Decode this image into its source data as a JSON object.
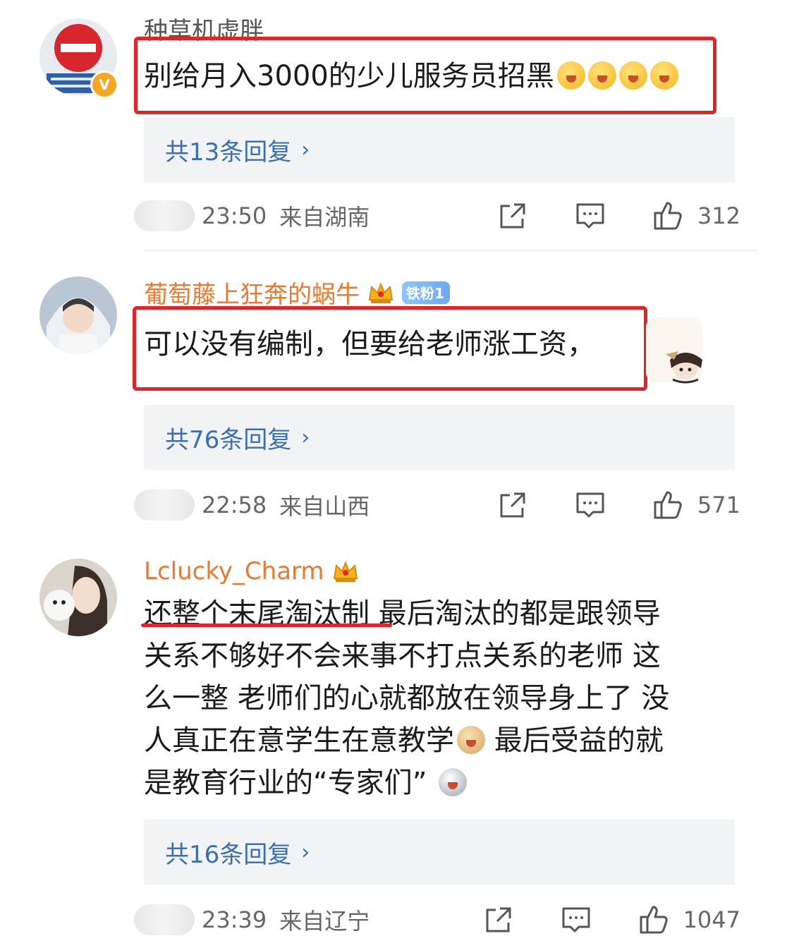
{
  "comments": [
    {
      "username": "种草机虚胖",
      "verified_badge": "V",
      "text": "别给月入3000的少儿服务员招黑",
      "emoji": [
        "grinning-sweat-emoji",
        "grinning-sweat-emoji",
        "grinning-sweat-emoji",
        "grinning-sweat-emoji"
      ],
      "replies": "共13条回复",
      "time": "23:50",
      "location": "来自湖南",
      "likes": "312"
    },
    {
      "username": "葡萄藤上狂奔的蜗牛",
      "fan_badge": "铁粉1",
      "text": "可以没有编制，但要给老师涨工资，",
      "replies": "共76条回复",
      "time": "22:58",
      "location": "来自山西",
      "likes": "571"
    },
    {
      "username": "Lclucky_Charm",
      "text_lines": [
        "还整个末尾淘汰制 最后淘汰的都是跟领导",
        "关系不够好不会来事不打点关系的老师 这",
        "么一整 老师们的心就都放在领导身上了 没",
        "人真正在意学生在意教学",
        "最后受益的就",
        "是教育行业的“专家们”"
      ],
      "replies": "共16条回复",
      "time": "23:39",
      "location": "来自辽宁",
      "likes": "1047"
    }
  ],
  "icons": {
    "share": "share-icon",
    "comment": "comment-icon",
    "like": "thumbs-up-icon",
    "chevron": "›"
  },
  "colors": {
    "username_orange": "#ec7a2e",
    "reply_link_blue": "#3a6fb5",
    "highlight_red": "#e0252a"
  }
}
